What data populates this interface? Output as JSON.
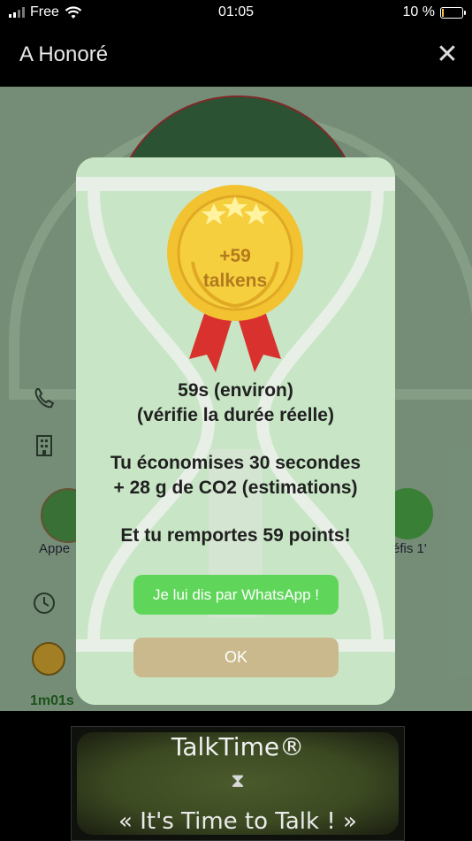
{
  "status_bar": {
    "carrier": "Free",
    "time": "01:05",
    "battery": "10 %",
    "battery_level": 0.1
  },
  "header": {
    "title": "A Honoré",
    "close_icon": "close-icon"
  },
  "background": {
    "call_label": "Appe",
    "dice_label": "éfis 1'",
    "bottom_text": "1m01s"
  },
  "modal": {
    "medal_amount": "+59",
    "medal_unit": "talkens",
    "line1": "59s (environ)",
    "line2": "(vérifie la durée réelle)",
    "line3": "Tu économises 30 secondes",
    "line4": "+ 28 g de CO2 (estimations)",
    "line5": "Et tu remportes 59 points!",
    "whatsapp_button": "Je lui dis par WhatsApp !",
    "ok_button": "OK"
  },
  "banner": {
    "title": "TalkTime®",
    "slogan": "« It's Time to Talk  ! »"
  },
  "colors": {
    "modal_bg": "#c7e6c5",
    "whatsapp": "#5fd65a",
    "ok": "#c9b98c",
    "medal_gold": "#f2c230",
    "ribbon_red": "#d9322e"
  }
}
